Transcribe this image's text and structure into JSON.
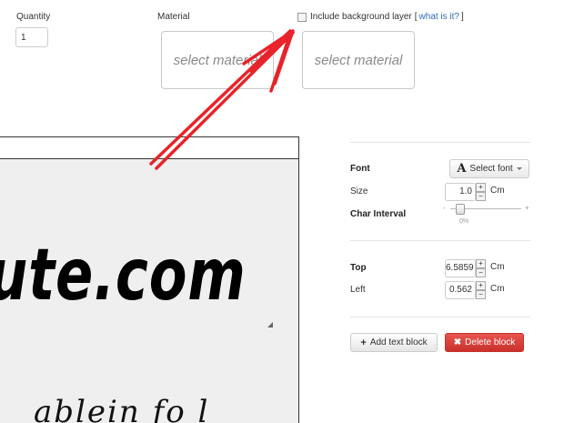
{
  "quantity": {
    "label": "Quantity",
    "value": "1"
  },
  "material": {
    "label": "Material",
    "boxes": [
      "select material",
      "select material"
    ]
  },
  "background_layer": {
    "label": "Include background layer",
    "bracket_open": "[",
    "help_link": "what is it?",
    "bracket_close": "]",
    "checked": false
  },
  "canvas": {
    "main_text": "ute.com",
    "script_text": "ablein fo l"
  },
  "properties": {
    "font_label": "Font",
    "select_font_label": "Select font",
    "font_icon": "A",
    "size_label": "Size",
    "size_value": "1.0",
    "size_unit": "Cm",
    "char_interval_label": "Char Interval",
    "char_interval_value": "0%",
    "char_interval_level": 0,
    "top_label": "Top",
    "top_value": "6.5859",
    "top_unit": "Cm",
    "left_label": "Left",
    "left_value": "0.562",
    "left_unit": "Cm"
  },
  "actions": {
    "add_text_block": "Add text block",
    "delete_block": "Delete block"
  },
  "colors": {
    "delete_button": "#d9534f",
    "link": "#2a6fb5",
    "arrow": "#e8232a"
  }
}
